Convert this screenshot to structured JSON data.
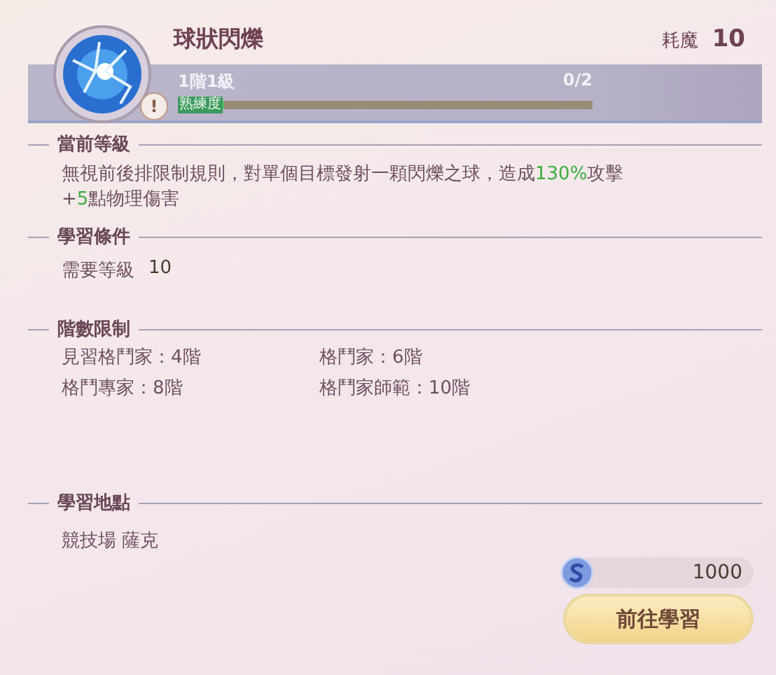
{
  "skill": {
    "name": "球狀閃爍",
    "cost_label": "耗魔",
    "cost": "10",
    "tier": "1階1級",
    "progress": "0/2",
    "progress_label": "熟練度",
    "level": 0,
    "warning": "!"
  },
  "sections": [
    {
      "kind": "text",
      "title": "當前等級",
      "text": "無視前後排限制規則，對單個目標發射一顆閃爍之球，造成**130%**攻擊+**5**點物理傷害"
    },
    {
      "kind": "requirement",
      "title": "學習條件",
      "label": "需要等級",
      "value": "10"
    },
    {
      "kind": "grid",
      "title": "階數限制",
      "items": [
        "見習格鬥家：4階",
        "格鬥家：6階",
        "格鬥專家：8階",
        "格鬥家師範：10階"
      ]
    },
    {
      "kind": "plain",
      "title": "學習地點",
      "text": "競技場  薩克"
    }
  ],
  "price": "1000",
  "button": "前往學習"
}
